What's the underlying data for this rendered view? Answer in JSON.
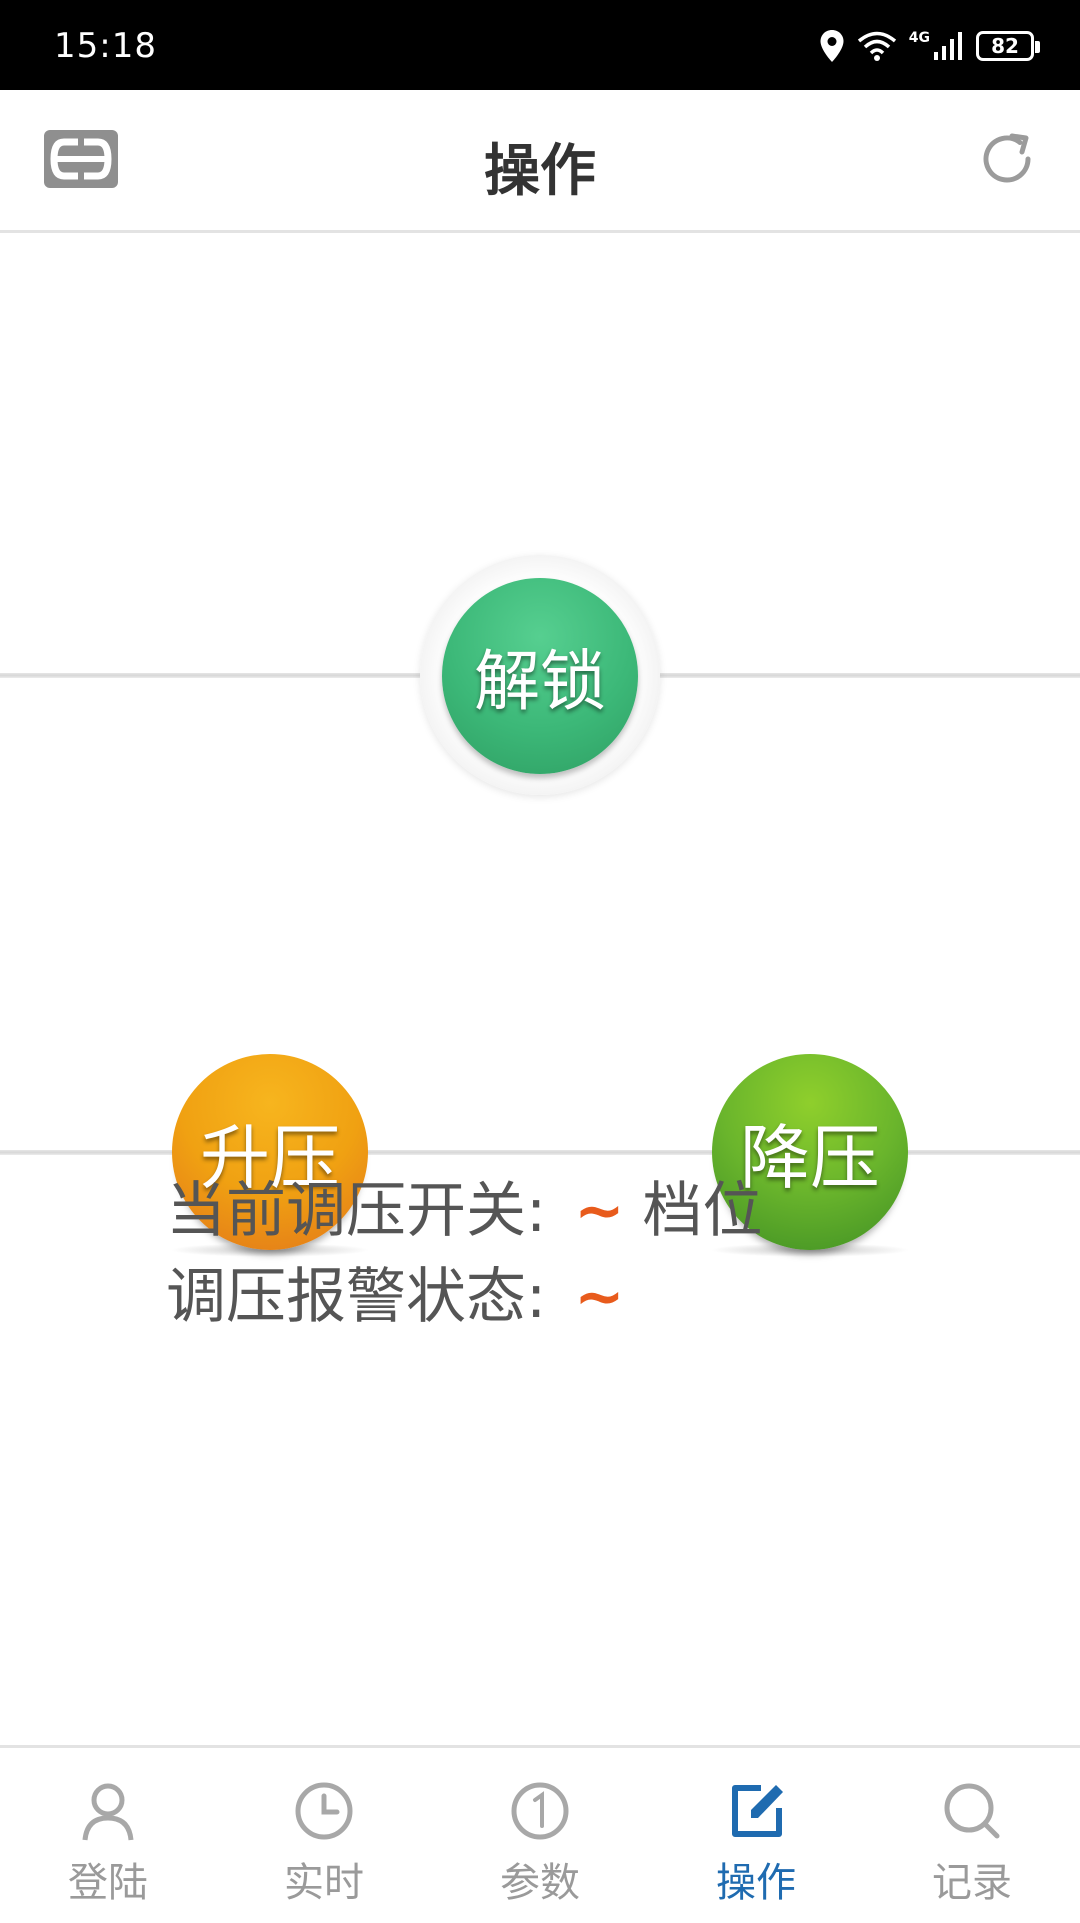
{
  "status_bar": {
    "time": "15:18",
    "battery": "82",
    "network": "4G"
  },
  "header": {
    "title": "操作"
  },
  "buttons": {
    "unlock": "解锁",
    "raise": "升压",
    "lower": "降压"
  },
  "status": {
    "tap_switch_label": "当前调压开关:",
    "tap_switch_value": "~",
    "tap_switch_unit": "档位",
    "alarm_label": "调压报警状态:",
    "alarm_value": "~"
  },
  "nav": {
    "items": [
      {
        "label": "登陆",
        "icon": "user-icon"
      },
      {
        "label": "实时",
        "icon": "clock-icon"
      },
      {
        "label": "参数",
        "icon": "number-one-icon"
      },
      {
        "label": "操作",
        "icon": "edit-icon",
        "active": true
      },
      {
        "label": "记录",
        "icon": "search-icon"
      }
    ]
  },
  "colors": {
    "accent": "#1f6bb0",
    "unlock": "#3cb878",
    "raise": "#f0a112",
    "lower": "#6ab52c",
    "value": "#e85b1c"
  }
}
